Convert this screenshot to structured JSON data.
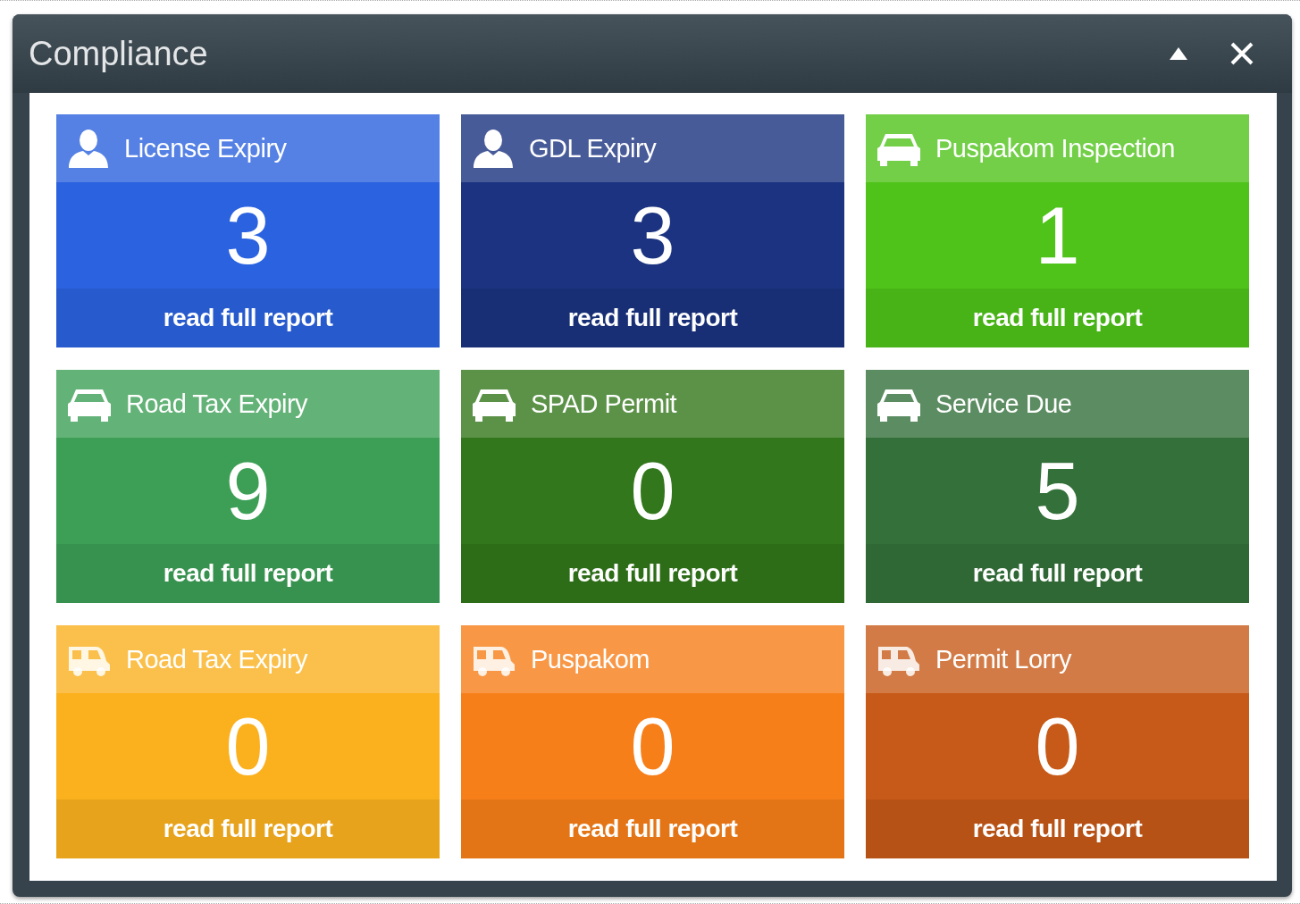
{
  "window": {
    "title": "Compliance"
  },
  "tiles": [
    {
      "title": "License Expiry",
      "kind": "person",
      "count": "3",
      "link": "read full report",
      "color": "#2b62df"
    },
    {
      "title": "GDL Expiry",
      "kind": "person",
      "count": "3",
      "link": "read full report",
      "color": "#1b3380"
    },
    {
      "title": "Puspakom Inspection",
      "kind": "car",
      "count": "1",
      "link": "read full report",
      "color": "#4fc31a"
    },
    {
      "title": "Road Tax Expiry",
      "kind": "car",
      "count": "9",
      "link": "read full report",
      "color": "#3d9f56"
    },
    {
      "title": "SPAD Permit",
      "kind": "car",
      "count": "0",
      "link": "read full report",
      "color": "#32771b"
    },
    {
      "title": "Service Due",
      "kind": "car",
      "count": "5",
      "link": "read full report",
      "color": "#34703a"
    },
    {
      "title": "Road Tax Expiry",
      "kind": "van",
      "count": "0",
      "link": "read full report",
      "color": "#fbb11e"
    },
    {
      "title": "Puspakom",
      "kind": "van",
      "count": "0",
      "link": "read full report",
      "color": "#f77f1a"
    },
    {
      "title": "Permit Lorry",
      "kind": "van",
      "count": "0",
      "link": "read full report",
      "color": "#c75a18"
    }
  ]
}
